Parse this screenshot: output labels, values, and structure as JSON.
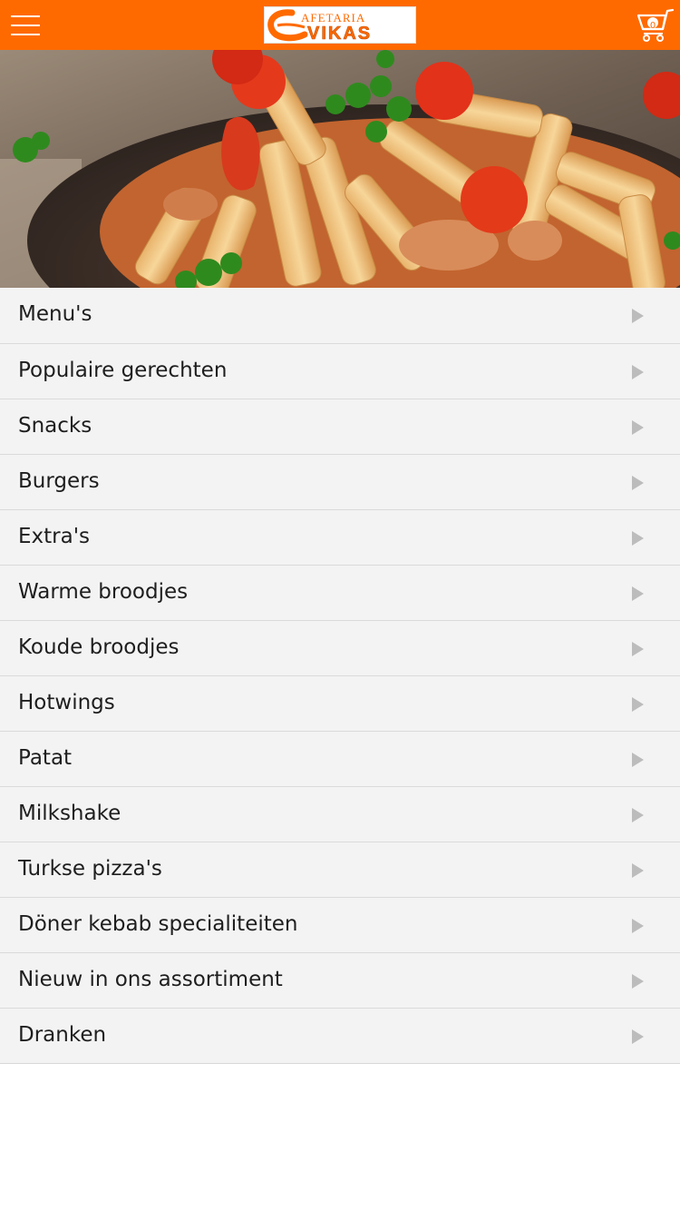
{
  "header": {
    "menu_icon": "hamburger-icon",
    "logo": {
      "icon": "cafetaria-vikas-logo",
      "line1": "AFETARIA",
      "line2": "VIKAS",
      "accent_color": "#ff6a00"
    },
    "cart": {
      "icon": "shopping-cart-icon",
      "count": "0"
    },
    "background_color": "#ff6a00"
  },
  "hero": {
    "icon": "pasta-dish-photo"
  },
  "menu": {
    "arrow_icon": "triangle-right-icon",
    "items": [
      {
        "label": "Menu's"
      },
      {
        "label": "Populaire gerechten"
      },
      {
        "label": "Snacks"
      },
      {
        "label": "Burgers"
      },
      {
        "label": "Extra's"
      },
      {
        "label": "Warme broodjes"
      },
      {
        "label": "Koude broodjes"
      },
      {
        "label": "Hotwings"
      },
      {
        "label": "Patat"
      },
      {
        "label": "Milkshake"
      },
      {
        "label": "Turkse pizza's"
      },
      {
        "label": "Döner kebab specialiteiten"
      },
      {
        "label": "Nieuw in ons assortiment"
      },
      {
        "label": "Dranken"
      }
    ]
  }
}
